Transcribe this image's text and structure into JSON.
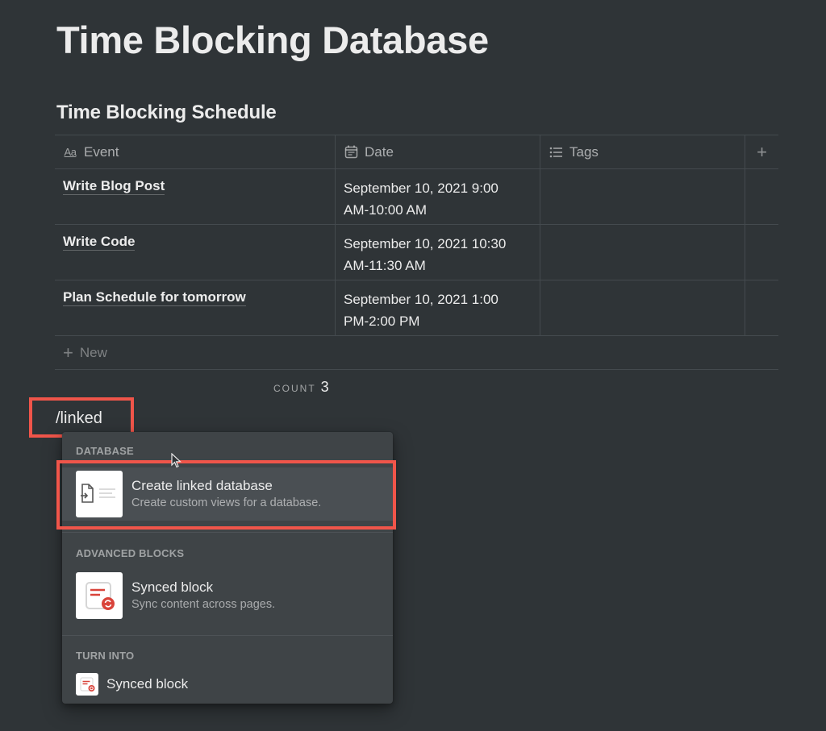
{
  "page": {
    "title": "Time Blocking Database"
  },
  "database": {
    "title": "Time Blocking Schedule",
    "columns": [
      {
        "label": "Event",
        "icon": "text-property-icon"
      },
      {
        "label": "Date",
        "icon": "calendar-icon"
      },
      {
        "label": "Tags",
        "icon": "list-icon"
      }
    ],
    "add_column_label": "+",
    "rows": [
      {
        "event": "Write Blog Post",
        "date_line1": "September 10, 2021 9:00",
        "date_line2": "AM-10:00 AM",
        "tags": ""
      },
      {
        "event": "Write Code",
        "date_line1": "September 10, 2021 10:30",
        "date_line2": "AM-11:30 AM",
        "tags": ""
      },
      {
        "event": "Plan Schedule for tomorrow",
        "date_line1": "September 10, 2021 1:00",
        "date_line2": "PM-2:00 PM",
        "tags": ""
      }
    ],
    "new_label": "New",
    "count_label": "COUNT",
    "count_value": "3"
  },
  "command": {
    "input_text": "/linked"
  },
  "menu": {
    "sections": [
      {
        "label": "DATABASE",
        "items": [
          {
            "title": "Create linked database",
            "description": "Create custom views for a database.",
            "icon": "linked-database-icon",
            "selected": true
          }
        ]
      },
      {
        "label": "ADVANCED BLOCKS",
        "items": [
          {
            "title": "Synced block",
            "description": "Sync content across pages.",
            "icon": "synced-block-icon"
          }
        ]
      },
      {
        "label": "TURN INTO",
        "items": [
          {
            "title": "Synced block",
            "icon": "synced-block-icon"
          }
        ]
      }
    ]
  },
  "annotations": {
    "highlight_color": "#f0554a"
  }
}
